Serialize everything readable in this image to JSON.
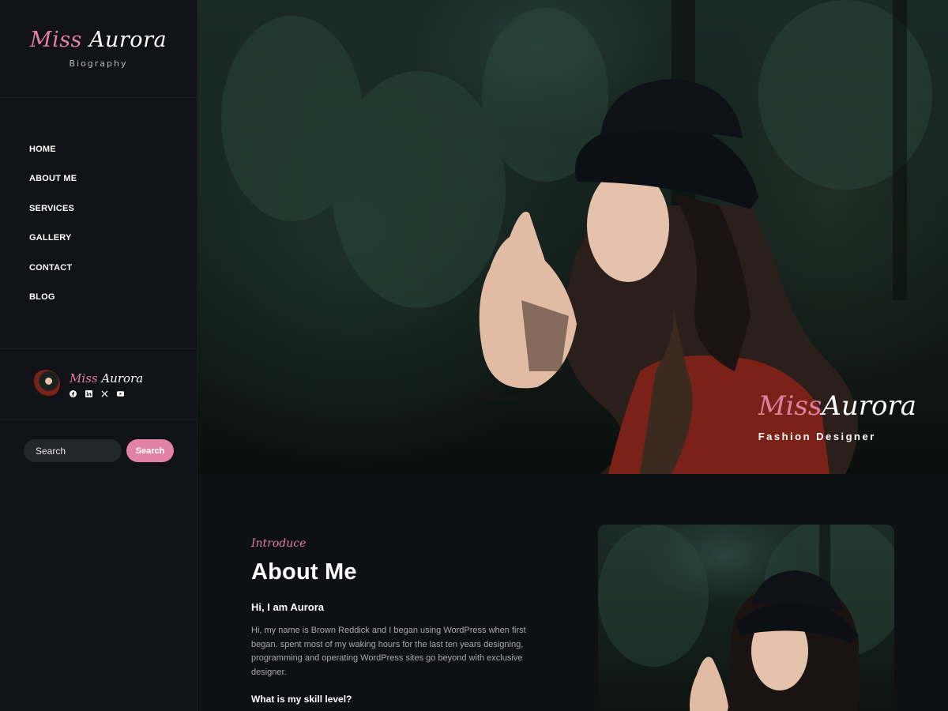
{
  "brand": {
    "name_first": "Miss",
    "name_last": "Aurora",
    "subtitle": "Biography"
  },
  "nav": [
    {
      "label": "HOME"
    },
    {
      "label": "ABOUT ME"
    },
    {
      "label": "SERVICES"
    },
    {
      "label": "GALLERY"
    },
    {
      "label": "CONTACT"
    },
    {
      "label": "BLOG"
    }
  ],
  "profile": {
    "name_first": "Miss",
    "name_last": "Aurora",
    "socials": [
      "facebook-icon",
      "linkedin-icon",
      "x-icon",
      "youtube-icon"
    ]
  },
  "search": {
    "placeholder": "Search",
    "button_label": "Search"
  },
  "hero": {
    "name_first": "Miss",
    "name_last": "Aurora",
    "role": "Fashion Designer"
  },
  "about": {
    "kicker": "Introduce",
    "title": "About Me",
    "heading": "Hi, I am Aurora",
    "paragraph": "Hi, my name is Brown Reddick and I began using WordPress when first began. spent most of my waking hours for the last ten years designing, programming and operating WordPress sites go beyond with exclusive designer.",
    "heading2": "What is my skill level?"
  },
  "colors": {
    "accent": "#e283a6",
    "background": "#0f1014",
    "sidebar": "#111217"
  }
}
